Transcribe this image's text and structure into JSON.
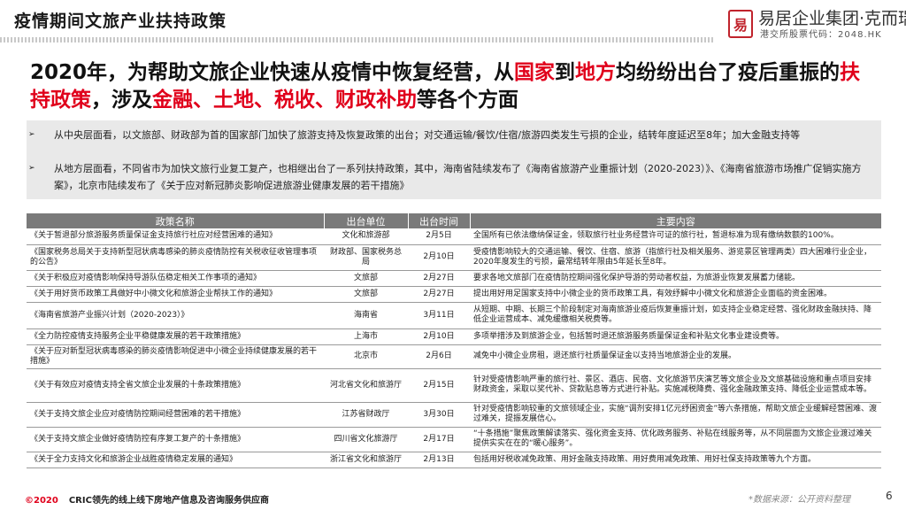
{
  "header": {
    "title": "疫情期间文旅产业扶持政策",
    "logo": {
      "seal_char": "易",
      "name": "易居企业集团·克而瑞",
      "stock_code": "港交所股票代码：2048.HK"
    }
  },
  "headline": {
    "parts": [
      {
        "text": "2020年，为帮助文旅企业快速从疫情中恢复经营，从",
        "hl": false
      },
      {
        "text": "国家",
        "hl": true
      },
      {
        "text": "到",
        "hl": false
      },
      {
        "text": "地方",
        "hl": true
      },
      {
        "text": "均纷纷出台了疫后重振的",
        "hl": false
      },
      {
        "text": "扶持政策",
        "hl": true
      },
      {
        "text": "，涉及",
        "hl": false
      },
      {
        "text": "金融、土地、税收、财政补助",
        "hl": true
      },
      {
        "text": "等各个方面",
        "hl": false
      }
    ],
    "highlight_color": "#e0001b"
  },
  "summary": {
    "bullets": [
      {
        "arrow": "➢",
        "text": "从中央层面看，以文旅部、财政部为首的国家部门加快了旅游支持及恢复政策的出台；对交通运输/餐饮/住宿/旅游四类发生亏损的企业，结转年度延迟至8年；加大金融支持等"
      },
      {
        "arrow": "➢",
        "text": "从地方层面看，不同省市为加快文旅行业复工复产，也相继出台了一系列扶持政策，其中，海南省陆续发布了《海南省旅游产业重振计划（2020-2023）》、《海南省旅游市场推广促销实施方案》，北京市陆续发布了《关于应对新冠肺炎影响促进旅游业健康发展的若干措施》"
      }
    ]
  },
  "table": {
    "headers": [
      "政策名称",
      "出台单位",
      "出台时间",
      "主要内容"
    ],
    "rows": [
      {
        "name": "《关于暂退部分旅游服务质量保证金支持旅行社应对经营困难的通知》",
        "unit": "文化和旅游部",
        "date": "2月5日",
        "content": "全国所有已依法缴纳保证金，领取旅行社业务经营许可证的旅行社，暂退标准为现有缴纳数额的100%。"
      },
      {
        "name": "《国家税务总局关于支持新型冠状病毒感染的肺炎疫情防控有关税收征收管理事项的公告》",
        "unit": "财政部、国家税务总局",
        "date": "2月10日",
        "content": "受疫情影响较大的交通运输、餐饮、住宿、旅游（指旅行社及相关服务、游览景区管理两类）四大困难行业企业，2020年度发生的亏损，最常结转年限由5年延长至8年。"
      },
      {
        "name": "《关于积极应对疫情影响保持导游队伍稳定相关工作事项的通知》",
        "unit": "文旅部",
        "date": "2月27日",
        "content": "要求各地文旅部门在疫情防控期间强化保护导游的劳动者权益，为旅游业恢复发展蓄力储能。"
      },
      {
        "name": "《关于用好货币政策工具做好中小微文化和旅游企业帮扶工作的通知》",
        "unit": "文旅部",
        "date": "2月27日",
        "content": "提出用好用足国家支持中小微企业的货币政策工具，有效纾解中小微文化和旅游企业面临的资金困难。"
      },
      {
        "name": "《海南省旅游产业振兴计划（2020-2023）》",
        "unit": "海南省",
        "date": "3月11日",
        "content": "从短期、中期、长期三个阶段制定对海南旅游业疫后恢复重振计划，如支持企业稳定经营、强化财政金融扶持、降低企业运营成本、减免缓缴相关税费等。"
      },
      {
        "name": "《全力防控疫情支持服务企业平稳健康发展的若干政策措施》",
        "unit": "上海市",
        "date": "2月10日",
        "content": "多项举措涉及到旅游企业，包括暂时退还旅游服务质量保证金和补贴文化事业建设费等。"
      },
      {
        "name": "《关于应对新型冠状病毒感染的肺炎疫情影响促进中小微企业持续健康发展的若干措施》",
        "unit": "北京市",
        "date": "2月6日",
        "content": "减免中小微企业房租，退还旅行社质量保证金以支持当地旅游企业的发展。"
      },
      {
        "name": "《关于有效应对疫情支持全省文旅企业发展的十条政策措施》",
        "unit": "河北省文化和旅游厅",
        "date": "2月15日",
        "content": "针对受疫情影响严重的旅行社、景区、酒店、民宿、文化旅游节庆演艺等文旅企业及文旅基础设施和重点项目安排财政资金，采取以奖代补、贷款贴息等方式进行补贴。实施减税降费、强化金融政策支持、降低企业运营成本等。"
      },
      {
        "name": "《关于支持文旅企业应对疫情防控期间经营困难的若干措施》",
        "unit": "江苏省财政厅",
        "date": "3月30日",
        "content": "针对受疫情影响较重的文旅领域企业，实施“调剂安排1亿元纾困资金”等六条措施，帮助文旅企业缓解经营困难、渡过难关，提振发展信心。"
      },
      {
        "name": "《关于支持文旅企业做好疫情防控有序复工复产的十条措施》",
        "unit": "四川省文化旅游厅",
        "date": "2月17日",
        "content": "“十条措施”聚焦政策解读落实、强化资金支持、优化政务服务、补贴在线服务等，从不同层面为文旅企业渡过难关提供实实在在的“暖心服务”。"
      },
      {
        "name": "《关于全力支持文化和旅游企业战胜疫情稳定发展的通知》",
        "unit": "浙江省文化和旅游厅",
        "date": "2月13日",
        "content": "包括用好税收减免政策、用好金融支持政策、用好费用减免政策、用好社保支持政策等九个方面。"
      }
    ]
  },
  "footer": {
    "copyright": "©2020",
    "company": "CRIC领先的线上线下房地产信息及咨询服务供应商",
    "source": "*数据来源：公开资料整理",
    "page": "6"
  }
}
